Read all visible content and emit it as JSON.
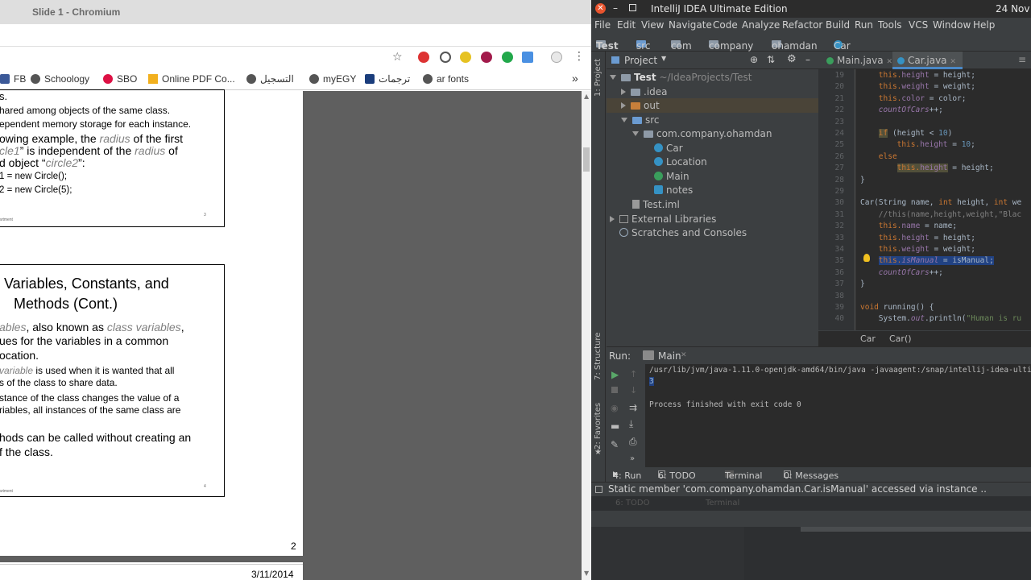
{
  "chrome": {
    "window_title": "Slide 1 - Chromium",
    "bookmarks": [
      "FB",
      "Schoology",
      "SBO",
      "Online PDF Co...",
      "التسجيل",
      "myEGY",
      "ترجمات",
      "ar fonts"
    ],
    "overflow": "»",
    "slide1": {
      "line1": "s.",
      "line2": "hared among objects of the same class.",
      "line3": "ependent memory storage for each instance.",
      "line4a": "owing example, the ",
      "line4b": "radius",
      "line4c": " of the first",
      "line5a": "cle1",
      "line5b": "” is independent of the ",
      "line5c": "radius",
      "line5d": " of",
      "line6a": "d object “",
      "line6b": "circle2",
      "line6c": "”:",
      "code1": "1 = new Circle();",
      "code2": "2 = new Circle(5);",
      "footer": "artment",
      "page_num": "3"
    },
    "slide2": {
      "title1": "Variables, Constants, and",
      "title2": "Methods (Cont.)",
      "p1a": "ables",
      "p1b": ", also known as ",
      "p1c": "class variables",
      "p1d": ",",
      "p2": "ues for the variables in a common",
      "p3": "ocation.",
      "p4a": "variable",
      "p4b": " is used when it is wanted that all",
      "p5": "s of the class to share data.",
      "p6": "stance of the class changes the value of a",
      "p7": "riables, all instances of the same class are",
      "p8": "hods can be called without creating an",
      "p9": "f the class.",
      "footer": "artment",
      "page_num": "4"
    },
    "viewer_page": "2",
    "date": "3/11/2014"
  },
  "ij": {
    "title": "IntelliJ IDEA Ultimate Edition",
    "clock": "24 Nov",
    "menu": [
      "File",
      "Edit",
      "View",
      "Navigate",
      "Code",
      "Analyze",
      "Refactor",
      "Build",
      "Run",
      "Tools",
      "VCS",
      "Window",
      "Help"
    ],
    "nav": [
      "Test",
      "src",
      "com",
      "company",
      "ohamdan",
      "Car"
    ],
    "project_label": "Project",
    "tree": {
      "root": "Test",
      "root_path": "~/IdeaProjects/Test",
      "idea": ".idea",
      "out": "out",
      "src": "src",
      "pkg": "com.company.ohamdan",
      "car": "Car",
      "location": "Location",
      "main": "Main",
      "notes": "notes",
      "iml": "Test.iml",
      "ext": "External Libraries",
      "scratch": "Scratches and Consoles"
    },
    "tabs": [
      "Main.java",
      "Car.java"
    ],
    "gutter": [
      "19",
      "20",
      "21",
      "22",
      "23",
      "24",
      "25",
      "26",
      "27",
      "28",
      "29",
      "30",
      "31",
      "32",
      "33",
      "34",
      "35",
      "36",
      "37",
      "38",
      "39",
      "40"
    ],
    "code": {
      "l19a": "this.",
      "l19b": "height",
      "l19c": " = height;",
      "l20a": "this.",
      "l20b": "weight",
      "l20c": " = weight;",
      "l21a": "this.",
      "l21b": "color",
      "l21c": " = color;",
      "l22a": "countOfCars",
      "l22b": "++;",
      "l24a": "if",
      "l24b": " (height < ",
      "l24c": "10",
      "l24d": ")",
      "l25a": "this.",
      "l25b": "height",
      "l25c": " = ",
      "l25d": "10",
      "l25e": ";",
      "l26": "else",
      "l27a": "this.",
      "l27b": "height",
      "l27c": " = height;",
      "l28": "}",
      "l30a": "Car(String name, ",
      "l30b": "int",
      "l30c": " height, ",
      "l30d": "int",
      "l30e": " we",
      "l31": "//this(name,height,weight,\"Blac",
      "l32a": "this.",
      "l32b": "name",
      "l32c": " = name;",
      "l33a": "this.",
      "l33b": "height",
      "l33c": " = height;",
      "l34a": "this.",
      "l34b": "weight",
      "l34c": " = weight;",
      "l35a": "this.",
      "l35b": "isManual",
      "l35c": " = isManual;",
      "l36a": "countOfCars",
      "l36b": "++;",
      "l37": "}",
      "l39a": "void",
      "l39b": " running() {",
      "l40a": "System.",
      "l40b": "out",
      "l40c": ".println(",
      "l40d": "\"Human is ru"
    },
    "breadcrumb": [
      "Car",
      "Car()"
    ],
    "run_label": "Run:",
    "run_config": "Main",
    "output": {
      "cmd": "/usr/lib/jvm/java-1.11.0-openjdk-amd64/bin/java -javaagent:/snap/intellij-idea-ultima",
      "result": "3",
      "exit": "Process finished with exit code 0"
    },
    "bottom_tabs": [
      "4: Run",
      "6: TODO",
      "Terminal",
      "0: Messages"
    ],
    "status": "Static member 'com.company.ohamdan.Car.isManual' accessed via instance ..",
    "ghost_tabs": [
      "6: TODO",
      "Terminal"
    ],
    "side_labels": [
      "1: Project",
      "7: Structure",
      "2: Favorites"
    ]
  }
}
